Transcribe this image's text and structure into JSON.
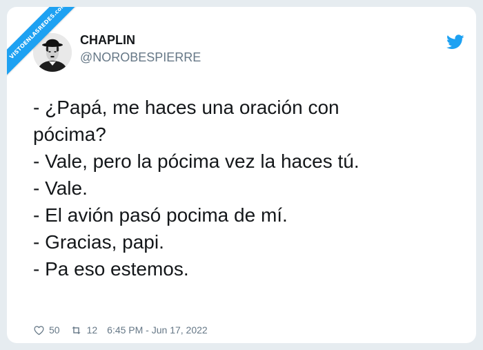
{
  "watermark": {
    "text": "VISTOENLASREDES.com"
  },
  "tweet": {
    "author": {
      "name": "CHAPLIN",
      "handle": "@NOROBESPIERRE",
      "avatar_icon": "chaplin-avatar"
    },
    "platform_icon": "twitter-bird-icon",
    "lines": [
      "- ¿Papá, me haces una oración con",
      "pócima?",
      "- Vale, pero la pócima vez la haces tú.",
      "- Vale.",
      "- El avión pasó pocima de mí.",
      "- Gracias, papi.",
      "- Pa eso estemos."
    ],
    "stats": {
      "likes": "50",
      "retweets": "12"
    },
    "timestamp": "6:45 PM - Jun 17, 2022"
  },
  "colors": {
    "background": "#e6ecf0",
    "card": "#ffffff",
    "text": "#14171a",
    "secondary": "#657786",
    "twitter_blue": "#1da1f2"
  }
}
